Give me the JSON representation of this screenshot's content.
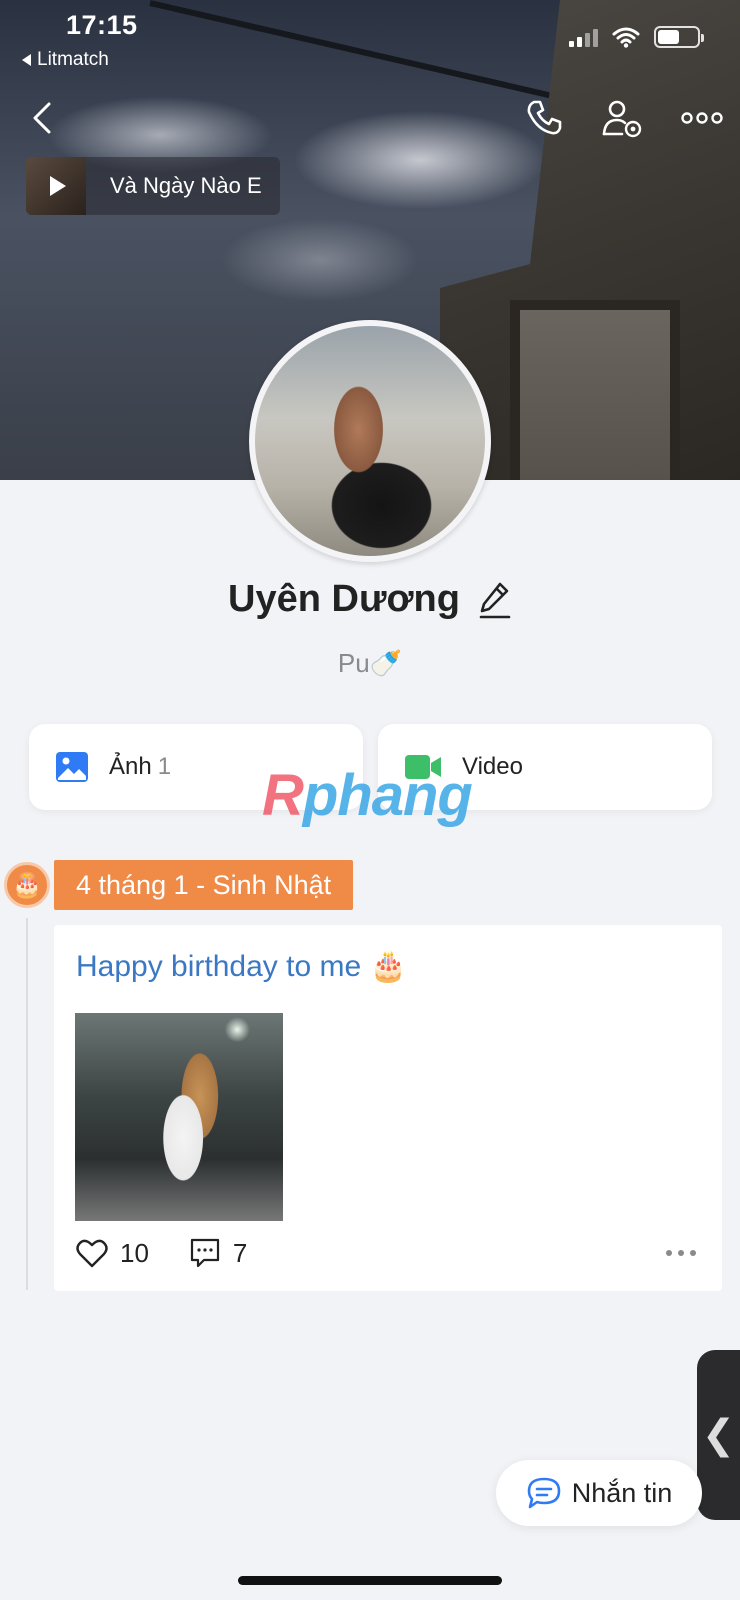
{
  "status_bar": {
    "time": "17:15",
    "back_app_label": "Litmatch",
    "battery_level": 0.55
  },
  "header": {
    "back_icon": "chevron-left-icon",
    "call_icon": "phone-icon",
    "settings_icon": "user-settings-icon",
    "more_icon": "more-horizontal-icon"
  },
  "music": {
    "title": "Và Ngày Nào E"
  },
  "profile": {
    "name": "Uyên Dương",
    "bio": "Pu🍼",
    "edit_icon": "pencil-icon"
  },
  "media_tabs": [
    {
      "label": "Ảnh",
      "count": "1",
      "icon": "image-icon",
      "color": "#2f7bf5"
    },
    {
      "label": "Video",
      "count": "",
      "icon": "video-camera-icon",
      "color": "#3dbf6a"
    }
  ],
  "watermark": {
    "text": "Rphang"
  },
  "timeline": {
    "date_label": "4 tháng 1 - Sinh Nhật",
    "accent_color": "#f08a47",
    "posts": [
      {
        "text": "Happy birthday to me 🎂",
        "likes": "10",
        "comments": "7"
      }
    ]
  },
  "actions": {
    "message_label": "Nhắn tin",
    "side_tab_glyph": "❮"
  }
}
